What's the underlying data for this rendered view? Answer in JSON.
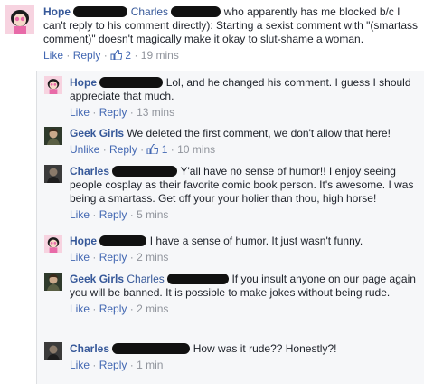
{
  "comments": [
    {
      "author": "Hope",
      "text_a": "Charles",
      "text_b": "who apparently has me blocked b/c I can't reply to his comment directly): Starting a sexist comment with \"(smartass comment)\" doesn't magically make it okay to slut-shame a woman.",
      "like": "Like",
      "reply": "Reply",
      "likes": "2",
      "time": "19 mins"
    }
  ],
  "replies": [
    {
      "author": "Hope",
      "text": "Lol, and he changed his comment. I guess I should appreciate that much.",
      "like": "Like",
      "reply": "Reply",
      "time": "13 mins"
    },
    {
      "author": "Geek Girls",
      "text": "We deleted the first comment, we don't allow that here!",
      "like": "Unlike",
      "reply": "Reply",
      "likes": "1",
      "time": "10 mins"
    },
    {
      "author": "Charles",
      "text": "Y'all have no sense of humor!! I enjoy seeing people cosplay as their favorite comic book person. It's awesome. I was being a smartass. Get off your your holier than thou, high horse!",
      "like": "Like",
      "reply": "Reply",
      "time": "5 mins"
    },
    {
      "author": "Hope",
      "text": "I have a sense of humor. It just wasn't funny.",
      "like": "Like",
      "reply": "Reply",
      "time": "2 mins"
    },
    {
      "author": "Geek Girls",
      "mention": "Charles",
      "text": "If you insult anyone on our page again you will be banned. It is possible to make jokes without being rude.",
      "like": "Like",
      "reply": "Reply",
      "time": "2 mins"
    },
    {
      "author": "Charles",
      "text": "How was it rude?? Honestly?!",
      "like": "Like",
      "reply": "Reply",
      "time": "1 min"
    }
  ],
  "separator": "·"
}
